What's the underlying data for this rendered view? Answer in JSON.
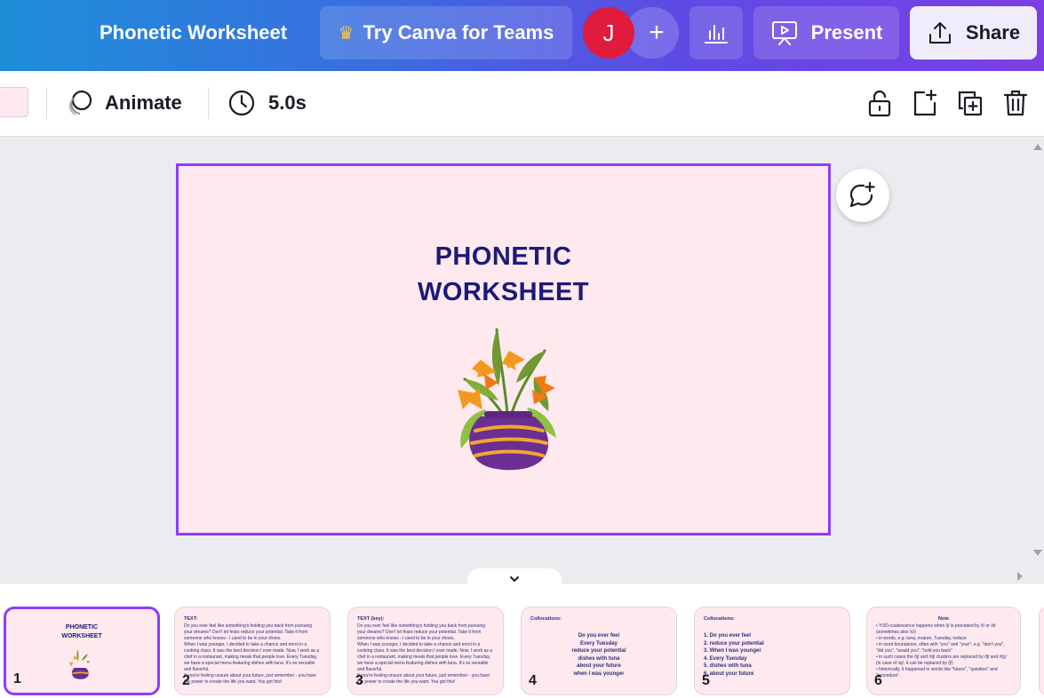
{
  "header": {
    "title": "Phonetic Worksheet",
    "teams_label": "Try Canva for Teams",
    "avatar_letter": "J",
    "add_label": "+",
    "present_label": "Present",
    "share_label": "Share"
  },
  "toolbar": {
    "animate_label": "Animate",
    "duration_label": "5.0s"
  },
  "slide": {
    "title_line1": "PHONETIC",
    "title_line2": "WORKSHEET"
  },
  "colors": {
    "accent": "#8b3dff",
    "slide_bg": "#fde9ee",
    "title_text": "#1b1a7a",
    "avatar": "#e01b3c"
  },
  "thumbnails": [
    {
      "num": "1",
      "title": "PHONETIC",
      "subtitle": "WORKSHEET",
      "selected": true
    },
    {
      "num": "2",
      "heading": "TEXT:",
      "lines": [
        "Do you ever feel like something's holding you back from pursuing your dreams? Don't let fears reduce your potential. Take it from someone who knows - I used to be in your shoes.",
        "When I was younger, I decided to take a chance and enrol in a cooking class. It was the best decision I ever made. Now, I work as a chef in a restaurant, making meals that people love. Every Tuesday, we have a special menu featuring dishes with tuna. It's so versatile and flavorful.",
        "If you're feeling unsure about your future, just remember - you have the power to create the life you want. You got this!"
      ]
    },
    {
      "num": "3",
      "heading": "TEXT (key):",
      "lines": [
        "Do you ever feel like something's holding you back from pursuing your dreams? Don't let fears reduce your potential. Take it from someone who knows - I used to be in your shoes.",
        "When I was younger, I decided to take a chance and enrol in a cooking class. It was the best decision I ever made. Now, I work as a chef in a restaurant, making meals that people love. Every Tuesday, we have a special menu featuring dishes with tuna. It's so versatile and flavorful.",
        "If you're feeling unsure about your future, just remember - you have the power to create the life you want. You got this!"
      ]
    },
    {
      "num": "4",
      "heading": "Collocations:",
      "items": [
        "Do you ever feel",
        "Every Tuesday",
        "reduce your potential",
        "dishes with tuna",
        "about your future",
        "when I was younger"
      ]
    },
    {
      "num": "5",
      "heading": "Collocations:",
      "items": [
        "1. Do you ever feel",
        "2. reduce your potential",
        "3. When I was younger",
        "4. Every Tuesday",
        "5. dishes with tuna",
        "6. about your future"
      ]
    },
    {
      "num": "6",
      "heading": "Note",
      "lines": [
        "• YOD-coalescence happens when /j/ is preceded by /t/ or /d/ (sometimes also /s/)",
        "• in words, e.g. tuna, mature, Tuesday, reduce",
        "• in word boundaries, often with \"you\" and \"your\", e.g. \"don't you\", \"did you\", \"would you\", \"hold you back\"",
        "• in such cases the /tj/ and /dj/ clusters are replaced by /tʃ/ and /dʒ/ (in case of /sj/, it can be replaced by /ʃ/)",
        "• historically, it happened in words like \"future\", \"question\" and \"procedure\"."
      ]
    }
  ]
}
